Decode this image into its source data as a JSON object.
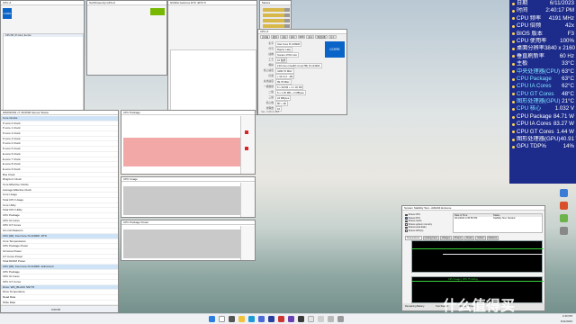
{
  "overlay": {
    "rows": [
      {
        "label": "日期",
        "value": "6/11/2023",
        "hl": false
      },
      {
        "label": "时间",
        "value": "2:40:17 PM",
        "hl": false
      },
      {
        "label": "CPU 频率",
        "value": "4191 MHz",
        "hl": false
      },
      {
        "label": "CPU 倍频",
        "value": "42x",
        "hl": false
      },
      {
        "label": "BIOS 版本",
        "value": "F3",
        "hl": false
      },
      {
        "label": "CPU 使用率",
        "value": "100%",
        "hl": false
      },
      {
        "label": "桌面分辨率",
        "value": "3840 x 2160",
        "hl": false
      },
      {
        "label": "垂直刷新率",
        "value": "60 Hz",
        "hl": false
      },
      {
        "label": "主板",
        "value": "33°C",
        "hl": false
      },
      {
        "label": "中央处理器(CPU)",
        "value": "63°C",
        "hl": true
      },
      {
        "label": "CPU Package",
        "value": "63°C",
        "hl": true
      },
      {
        "label": "CPU IA Cores",
        "value": "62°C",
        "hl": true
      },
      {
        "label": "CPU GT Cores",
        "value": "48°C",
        "hl": true
      },
      {
        "label": "图形处理器(GPU)",
        "value": "21°C",
        "hl": true
      },
      {
        "label": "CPU 核心",
        "value": "1.032 V",
        "hl": true
      },
      {
        "label": "CPU Package",
        "value": "84.71 W",
        "hl": false
      },
      {
        "label": "CPU IA Cores",
        "value": "83.27 W",
        "hl": false
      },
      {
        "label": "CPU GT Cores",
        "value": "1.44 W",
        "hl": false
      },
      {
        "label": "图形处理器(GPU)",
        "value": "40.91 W",
        "hl": false
      },
      {
        "label": "GPU TDP%",
        "value": "14%",
        "hl": false
      }
    ]
  },
  "cpuz": {
    "title": "CPU-Z",
    "tabs": [
      "处理器",
      "缓存",
      "主板",
      "内存",
      "SPD",
      "显卡",
      "测试分数",
      "关于"
    ],
    "fields": [
      {
        "k": "名字",
        "v": "Intel Core i5 13490F"
      },
      {
        "k": "代号",
        "v": "Raptor Lake"
      },
      {
        "k": "插槽",
        "v": "Socket 1700 LGA"
      },
      {
        "k": "工艺",
        "v": "10 纳米"
      },
      {
        "k": "规格",
        "v": "13th Gen Intel(R) Core(TM) i5-13490F"
      },
      {
        "k": "核心速度",
        "v": "4190.70 MHz"
      },
      {
        "k": "倍频",
        "v": "x 42.0 (4 - 48)"
      },
      {
        "k": "总线速度",
        "v": "99.78 MHz"
      },
      {
        "k": "一级数据",
        "v": "6 x 48 KB + 4 x 32 KB"
      },
      {
        "k": "二级",
        "v": "6 x 1.25 MB + 2 MBytes"
      },
      {
        "k": "三级",
        "v": "24 MBytes"
      },
      {
        "k": "核心数",
        "v": "6P + 4E"
      },
      {
        "k": "线程数",
        "v": "16"
      }
    ],
    "version": "Ver. 2.06.0.x64"
  },
  "hwinfo_left": {
    "title": "HWiNFO64 v7.46-5000 Sensor Status",
    "rows": [
      "Core Clocks",
      "P-core 0 Clock",
      "P-core 1 Clock",
      "P-core 2 Clock",
      "P-core 3 Clock",
      "P-core 4 Clock",
      "P-core 5 Clock",
      "E-core 6 Clock",
      "E-core 7 Clock",
      "E-core 8 Clock",
      "E-core 9 Clock",
      "Bus Clock",
      "Ring/LLC Clock",
      "Core Effective Clocks",
      "Average Effective Clock",
      "Core Usage",
      "Total CPU Usage",
      "Core Utility",
      "Total CPU Utility",
      "CPU Package",
      "CPU IA Cores",
      "CPU GT Cores",
      "IA Limit Reasons",
      "CPU [#0]: Intel Core i5-13490F: DTS",
      "Core Temperatures",
      "CPU Package Power",
      "IA Cores Power",
      "GT Cores Power",
      "Total DRAM Power",
      "CPU [#0]: Intel Core i5-13490F: Enhanced",
      "CPU Package",
      "CPU IA Cores",
      "CPU GT Cores",
      "Drive: WD_BLACK SN770",
      "Drive Temperature",
      "Read Rate",
      "Write Rate"
    ],
    "clock": "0:00:08"
  },
  "stability": {
    "title": "System Stability Test - AIDA64 Extreme",
    "checks": [
      "Stress CPU",
      "Stress FPU",
      "Stress cache",
      "Stress system memory",
      "Stress local disks",
      "Stress GPU(s)"
    ],
    "log_head": [
      "Date & Time",
      "Status"
    ],
    "log_row": [
      "6/11/2023 2:35:55 PM",
      "Stability Test: Started"
    ],
    "tabs": [
      "Temperatures",
      "Cooling Fans",
      "Voltages",
      "Powers",
      "Clocks",
      "Unified",
      "Statistics"
    ],
    "graph2_title": "CPU Usage | CPU Throttling",
    "remaining": "Remaining Battery:",
    "test_started": "Test Started:",
    "elapsed": "Elapsed Time:"
  },
  "taskbar": {
    "time": "2:40 PM",
    "date": "6/11/2023"
  },
  "watermark": "什么值得买"
}
